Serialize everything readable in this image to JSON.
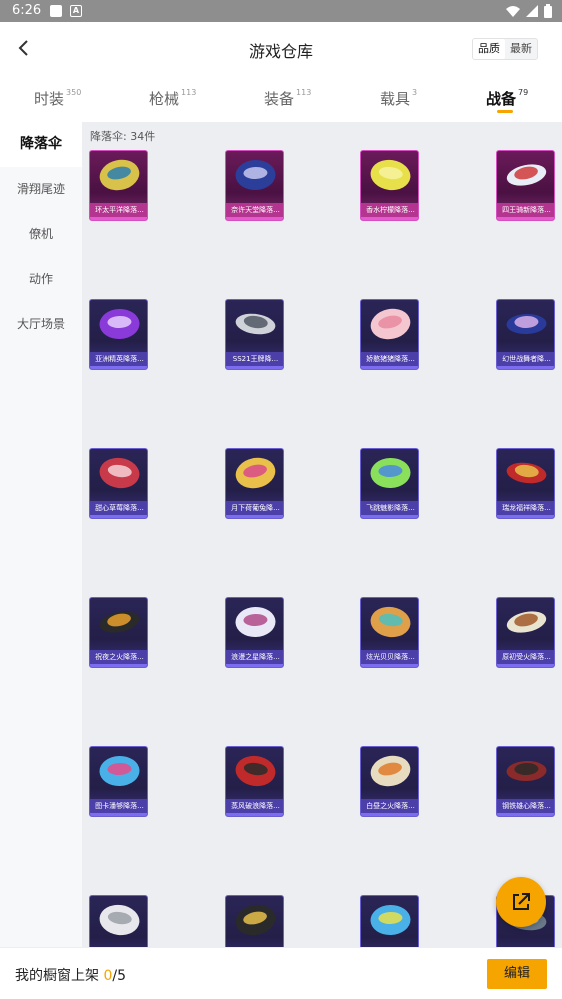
{
  "status_bar": {
    "time": "6:26",
    "icons": [
      "notification-square",
      "a-icon",
      "wifi-icon",
      "signal-icon",
      "battery-icon"
    ]
  },
  "header": {
    "title": "游戏仓库",
    "sort_options": [
      "品质",
      "最新"
    ],
    "sort_active": "品质"
  },
  "category_tabs": [
    {
      "label": "时装",
      "count": "350"
    },
    {
      "label": "枪械",
      "count": "113"
    },
    {
      "label": "装备",
      "count": "113"
    },
    {
      "label": "载具",
      "count": "3"
    },
    {
      "label": "战备",
      "count": "79"
    }
  ],
  "active_category": "战备",
  "sidebar": {
    "items": [
      "降落伞",
      "滑翔尾迹",
      "僚机",
      "动作",
      "大厅场景"
    ],
    "active": "降落伞"
  },
  "content": {
    "count_label": "降落伞: 34件"
  },
  "items": [
    {
      "name": "环太平洋降落...",
      "rarity": "legend",
      "colors": [
        "#d8c24a",
        "#2a7fb0"
      ]
    },
    {
      "name": "奈许天堂降落...",
      "rarity": "legend",
      "colors": [
        "#2a3e9a",
        "#c6c8f0"
      ]
    },
    {
      "name": "香水柠檬降落...",
      "rarity": "legend",
      "colors": [
        "#e8e04a",
        "#f6f2a0"
      ]
    },
    {
      "name": "四王骑新降落...",
      "rarity": "legend",
      "colors": [
        "#e8eef6",
        "#d03a3a"
      ]
    },
    {
      "name": "亚洲精英降落...",
      "rarity": "epic",
      "colors": [
        "#8a3ad8",
        "#e8d0ff"
      ]
    },
    {
      "name": "SS21王牌降...",
      "rarity": "epic",
      "colors": [
        "#cfd2d8",
        "#505864"
      ]
    },
    {
      "name": "娇憨猪猪降落...",
      "rarity": "epic",
      "colors": [
        "#f4c6d0",
        "#e88aa0"
      ]
    },
    {
      "name": "幻世战舞者降...",
      "rarity": "epic",
      "colors": [
        "#2a3a9a",
        "#d8b0e8"
      ]
    },
    {
      "name": "甜心草莓降落...",
      "rarity": "epic",
      "colors": [
        "#c83a4a",
        "#f6d2d6"
      ]
    },
    {
      "name": "月下荷葡兔降...",
      "rarity": "epic",
      "colors": [
        "#e8c04a",
        "#d84a8a"
      ]
    },
    {
      "name": "飞跳魅影降落...",
      "rarity": "epic",
      "colors": [
        "#8ae05a",
        "#4a8ae0"
      ]
    },
    {
      "name": "瑞龙福祥降落...",
      "rarity": "epic",
      "colors": [
        "#c02a2a",
        "#e8c04a"
      ]
    },
    {
      "name": "祝夜之火降落...",
      "rarity": "epic",
      "colors": [
        "#2a2a2a",
        "#e8a02a"
      ]
    },
    {
      "name": "浪漫之星降落...",
      "rarity": "epic",
      "colors": [
        "#e8e8f6",
        "#b04a8a"
      ]
    },
    {
      "name": "炫光贝贝降落...",
      "rarity": "epic",
      "colors": [
        "#e0a04a",
        "#4ac0c0"
      ]
    },
    {
      "name": "原初受火降落...",
      "rarity": "epic",
      "colors": [
        "#e8e4d0",
        "#a05a2a"
      ]
    },
    {
      "name": "图卡潘够降落...",
      "rarity": "epic",
      "colors": [
        "#4ab0e8",
        "#e84a8a"
      ]
    },
    {
      "name": "蒸风破浪降落...",
      "rarity": "epic",
      "colors": [
        "#c02a2a",
        "#2a2a2a"
      ]
    },
    {
      "name": "白昼之火降落...",
      "rarity": "epic",
      "colors": [
        "#e8dcc0",
        "#e07a2a"
      ]
    },
    {
      "name": "钢铁雄心降落...",
      "rarity": "epic",
      "colors": [
        "#8a2a2a",
        "#2a2a2a"
      ]
    },
    {
      "name": "",
      "rarity": "epic",
      "colors": [
        "#e8e8ec",
        "#9aa0a8"
      ]
    },
    {
      "name": "",
      "rarity": "epic",
      "colors": [
        "#2a2a2a",
        "#e8c04a"
      ]
    },
    {
      "name": "",
      "rarity": "epic",
      "colors": [
        "#4ab0e8",
        "#e8e04a"
      ]
    },
    {
      "name": "",
      "rarity": "epic",
      "colors": [
        "#6a7a8a",
        "#c0c8d0"
      ]
    }
  ],
  "bottom_bar": {
    "text": "我的橱窗上架",
    "current": "0",
    "total": "/5",
    "edit_label": "编辑"
  }
}
